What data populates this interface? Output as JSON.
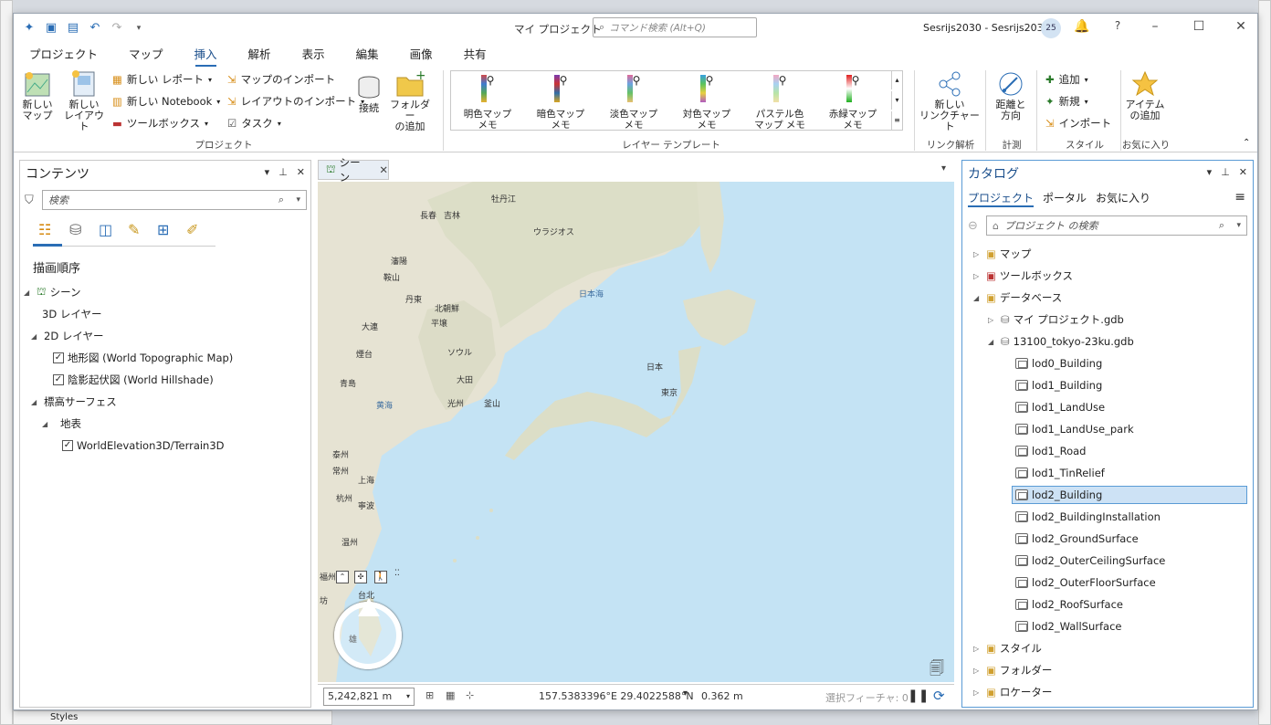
{
  "window": {
    "title": "マイ プロジェクト",
    "command_search_placeholder": "コマンド検索 (Alt+Q)",
    "user": "Sesrijs2030 - Sesrijs2030",
    "avatar_initials": "25",
    "help": "?"
  },
  "ribbon_tabs": [
    "プロジェクト",
    "マップ",
    "挿入",
    "解析",
    "表示",
    "編集",
    "画像",
    "共有"
  ],
  "ribbon": {
    "new_map": "新しい\nマップ",
    "new_layout": "新しい\nレイアウト",
    "new_report": "新しい レポート",
    "new_notebook": "新しい Notebook",
    "toolbox": "ツールボックス",
    "import_map": "マップのインポート",
    "import_layout": "レイアウトのインポート",
    "task": "タスク",
    "connect": "接続",
    "add_folder": "フォルダー\nの追加",
    "group_project": "プロジェクト",
    "layer_templates": [
      {
        "label": "明色マップ\nメモ",
        "colors": [
          "#d04a4a",
          "#3e7bd0",
          "#55a855",
          "#e8b030"
        ]
      },
      {
        "label": "暗色マップ\nメモ",
        "colors": [
          "#7a3ab0",
          "#c33",
          "#2f6fa8",
          "#d9a520"
        ]
      },
      {
        "label": "淡色マップ\nメモ",
        "colors": [
          "#e06b9a",
          "#6aa3e0",
          "#66c266",
          "#e8c070"
        ]
      },
      {
        "label": "対色マップ\nメモ",
        "colors": [
          "#38a0e0",
          "#5bc35b",
          "#e8d040",
          "#b05ac0"
        ]
      },
      {
        "label": "パステル色\nマップ メモ",
        "colors": [
          "#f2a7c2",
          "#a7d2f2",
          "#b7e4a7",
          "#f2e0a7"
        ]
      },
      {
        "label": "赤緑マップ\nメモ",
        "colors": [
          "#e02020",
          "#20b020",
          "#e02020",
          "#20b020"
        ]
      }
    ],
    "group_layer_template": "レイヤー テンプレート",
    "new_link_chart": "新しい\nリンクチャート",
    "group_link": "リンク解析",
    "distance_direction": "距離と\n方向",
    "group_measure": "計測",
    "style_add": "追加",
    "style_new": "新規",
    "style_import": "インポート",
    "group_style": "スタイル",
    "add_item": "アイテム\nの追加",
    "group_favorites": "お気に入り"
  },
  "contents": {
    "title": "コンテンツ",
    "search_placeholder": "検索",
    "drawing_order": "描画順序",
    "scene": "シーン",
    "layers_3d": "3D レイヤー",
    "layers_2d": "2D レイヤー",
    "topo": "地形図 (World Topographic Map)",
    "hillshade": "陰影起伏図 (World Hillshade)",
    "elevation_surfaces": "標高サーフェス",
    "ground": "地表",
    "terrain": "WorldElevation3D/Terrain3D"
  },
  "map": {
    "tab_label": "シーン",
    "scale": "5,242,821 m",
    "coords": "157.5383396°E 29.4022588°N",
    "distance": "0.362 m",
    "selected_features": "選択フィーチャ: 0",
    "labels": [
      {
        "t": "牡丹江"
      },
      {
        "t": "長春"
      },
      {
        "t": "吉林"
      },
      {
        "t": "ウラジオス"
      },
      {
        "t": "瀋陽"
      },
      {
        "t": "鞍山"
      },
      {
        "t": "丹東"
      },
      {
        "t": "北朝鮮"
      },
      {
        "t": "平壌"
      },
      {
        "t": "大連"
      },
      {
        "t": "ソウル"
      },
      {
        "t": "煙台"
      },
      {
        "t": "大田"
      },
      {
        "t": "青島"
      },
      {
        "t": "光州"
      },
      {
        "t": "釜山"
      },
      {
        "t": "日本海"
      },
      {
        "t": "日本"
      },
      {
        "t": "東京"
      },
      {
        "t": "黄海"
      },
      {
        "t": "泰州"
      },
      {
        "t": "常州"
      },
      {
        "t": "上海"
      },
      {
        "t": "杭州"
      },
      {
        "t": "寧波"
      },
      {
        "t": "温州"
      },
      {
        "t": "福州"
      },
      {
        "t": "台北"
      },
      {
        "t": "坊"
      },
      {
        "t": "雄"
      }
    ]
  },
  "catalog": {
    "title": "カタログ",
    "tabs": [
      "プロジェクト",
      "ポータル",
      "お気に入り"
    ],
    "search_placeholder": "プロジェクト の検索",
    "top_items": [
      "マップ",
      "ツールボックス",
      "データベース"
    ],
    "gdb1": "マイ プロジェクト.gdb",
    "gdb2": "13100_tokyo-23ku.gdb",
    "datasets": [
      "lod0_Building",
      "lod1_Building",
      "lod1_LandUse",
      "lod1_LandUse_park",
      "lod1_Road",
      "lod1_TinRelief",
      "lod2_Building",
      "lod2_BuildingInstallation",
      "lod2_GroundSurface",
      "lod2_OuterCeilingSurface",
      "lod2_OuterFloorSurface",
      "lod2_RoofSurface",
      "lod2_WallSurface"
    ],
    "bottom_items": [
      "スタイル",
      "フォルダー",
      "ロケーター"
    ]
  },
  "background": {
    "styles_label": "Styles"
  }
}
